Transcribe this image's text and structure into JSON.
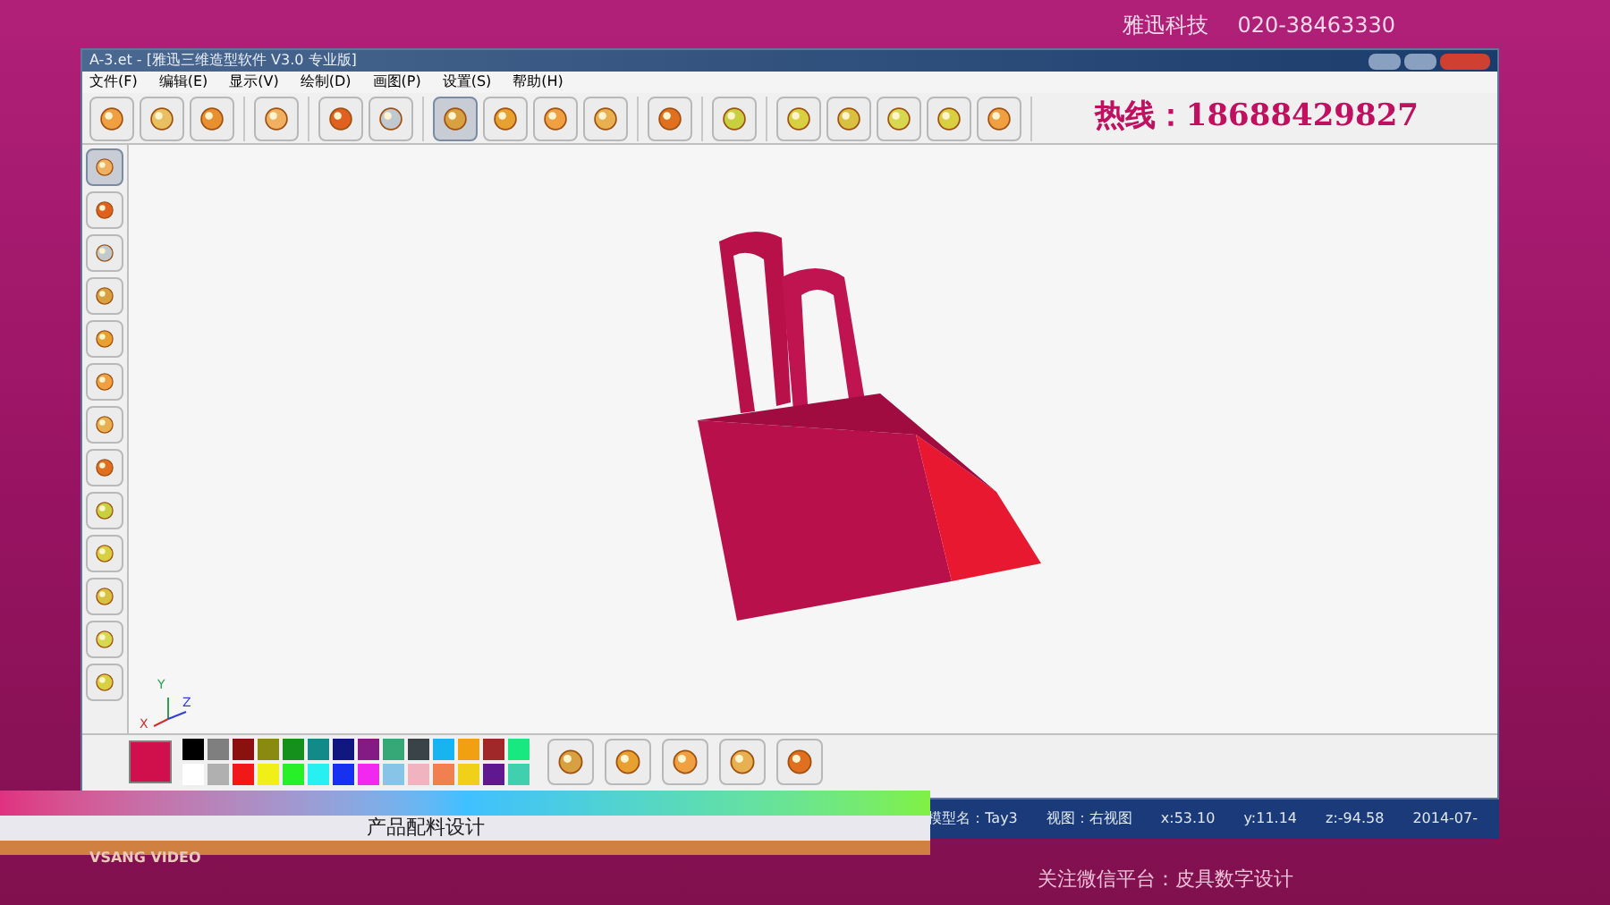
{
  "header": {
    "company": "雅迅科技",
    "phone": "020-38463330"
  },
  "window": {
    "title": "A-3.et - [雅迅三维造型软件 V3.0 专业版]"
  },
  "menu": [
    "文件(F)",
    "编辑(E)",
    "显示(V)",
    "绘制(D)",
    "画图(P)",
    "设置(S)",
    "帮助(H)"
  ],
  "toolbar_groups": [
    [
      {
        "selected": false
      },
      {
        "selected": false
      },
      {
        "selected": false
      }
    ],
    [
      {
        "selected": false
      }
    ],
    [
      {
        "selected": false
      },
      {
        "selected": false
      }
    ],
    [
      {
        "selected": true
      },
      {
        "selected": false
      },
      {
        "selected": false
      },
      {
        "selected": false
      }
    ],
    [
      {
        "selected": false
      }
    ],
    [
      {
        "selected": false
      }
    ],
    [
      {
        "selected": false
      },
      {
        "selected": false
      },
      {
        "selected": false
      },
      {
        "selected": false
      },
      {
        "selected": false
      }
    ]
  ],
  "hotline": "热线：18688429827",
  "side_tools": [
    {
      "selected": true
    },
    {
      "selected": false
    },
    {
      "selected": false
    },
    {
      "selected": false
    },
    {
      "selected": false
    },
    {
      "selected": false
    },
    {
      "selected": false
    },
    {
      "selected": false
    },
    {
      "selected": false
    },
    {
      "selected": false
    },
    {
      "selected": false
    },
    {
      "selected": false
    },
    {
      "selected": false
    }
  ],
  "axes": {
    "x": "X",
    "y": "Y",
    "z": "Z"
  },
  "current_swatch": {
    "color": "#d0104c"
  },
  "palette": [
    {
      "color": "#000000"
    },
    {
      "color": "#7f7f7f"
    },
    {
      "color": "#8b1010"
    },
    {
      "color": "#8a8a10"
    },
    {
      "color": "#16901c"
    },
    {
      "color": "#128a8a"
    },
    {
      "color": "#101880"
    },
    {
      "color": "#841a84"
    },
    {
      "color": "#36a878"
    },
    {
      "color": "#3a4448"
    },
    {
      "color": "#18b4f0"
    },
    {
      "color": "#f0a010"
    },
    {
      "color": "#a02828"
    },
    {
      "color": "#18e880"
    },
    {
      "color": "#ffffff"
    },
    {
      "color": "#b0b0b0"
    },
    {
      "color": "#f01818"
    },
    {
      "color": "#f0f018"
    },
    {
      "color": "#28f028"
    },
    {
      "color": "#28f0f0"
    },
    {
      "color": "#1830f0"
    },
    {
      "color": "#f028f0"
    },
    {
      "color": "#88c4e8"
    },
    {
      "color": "#f0b4c0"
    },
    {
      "color": "#f08050"
    },
    {
      "color": "#f0d018"
    },
    {
      "color": "#601890"
    },
    {
      "color": "#40d0b0"
    }
  ],
  "brush_tools": [
    {
      "selected": false
    },
    {
      "selected": false
    },
    {
      "selected": false
    },
    {
      "selected": false
    },
    {
      "selected": false
    }
  ],
  "status_bar": [
    "模型名：Tay3",
    "视图：右视图",
    "x:53.10",
    "y:11.14",
    "z:-94.58",
    "2014-07-"
  ],
  "caption": "产品配料设计",
  "brand": "VSANG VIDEO",
  "footer": "关注微信平台：皮具数字设计"
}
